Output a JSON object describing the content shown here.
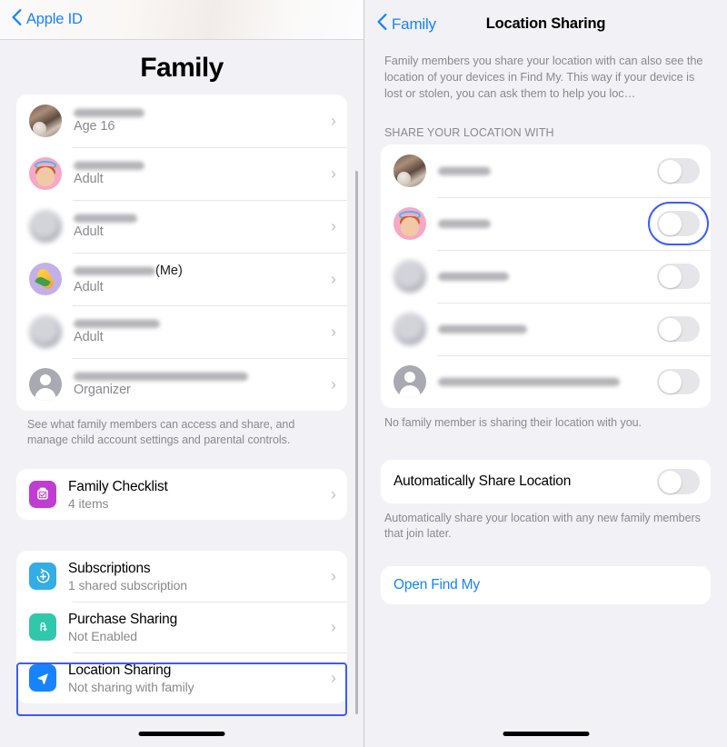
{
  "left_panel": {
    "back": {
      "label": "Apple ID",
      "icon": "chevron-left-icon"
    },
    "title": "Family",
    "members": [
      {
        "avatar": "photo-child",
        "name_redacted": true,
        "name_width": 78,
        "role": "Age 16"
      },
      {
        "avatar": "emoji-angel",
        "name_redacted": true,
        "name_width": 78,
        "role": "Adult"
      },
      {
        "avatar": "blurred-blob",
        "name_redacted": true,
        "name_width": 70,
        "role": "Adult"
      },
      {
        "avatar": "emoji-corn",
        "name_redacted": true,
        "name_width": 90,
        "suffix": "(Me)",
        "role": "Adult"
      },
      {
        "avatar": "blurred-blob",
        "name_redacted": true,
        "name_width": 95,
        "role": "Adult"
      },
      {
        "avatar": "person-placeholder",
        "name_redacted": true,
        "name_width": 192,
        "role": "Organizer"
      }
    ],
    "members_footnote": "See what family members can access and share, and manage child account settings and parental controls.",
    "checklist": {
      "icon": "clipboard-check-icon",
      "icon_color": "#bf3ed1",
      "title": "Family Checklist",
      "subtitle": "4 items"
    },
    "services": [
      {
        "icon": "subscriptions-icon",
        "icon_color": "#32ade6",
        "title": "Subscriptions",
        "subtitle": "1 shared subscription"
      },
      {
        "icon": "purchase-sharing-icon",
        "icon_color": "#2fc8ac",
        "title": "Purchase Sharing",
        "subtitle": "Not Enabled"
      },
      {
        "icon": "location-arrow-icon",
        "icon_color": "#1783ff",
        "title": "Location Sharing",
        "subtitle": "Not sharing with family"
      }
    ],
    "highlight_color": "#3b5bfd"
  },
  "right_panel": {
    "back": {
      "label": "Family",
      "icon": "chevron-left-icon"
    },
    "title": "Location Sharing",
    "description": "Family members you share your location with can also see the location of your devices in Find My. This way if your device is lost or stolen, you can ask them to help you loc…",
    "section_header": "SHARE YOUR LOCATION WITH",
    "share_rows": [
      {
        "avatar": "photo-child",
        "name_redacted": true,
        "name_width": 58,
        "toggle": "off",
        "selected": false
      },
      {
        "avatar": "emoji-angel",
        "name_redacted": true,
        "name_width": 58,
        "toggle": "off",
        "selected": true
      },
      {
        "avatar": "blurred-blob",
        "name_redacted": true,
        "name_width": 78,
        "toggle": "off",
        "selected": false
      },
      {
        "avatar": "blurred-blob",
        "name_redacted": true,
        "name_width": 98,
        "toggle": "off",
        "selected": false
      },
      {
        "avatar": "person-placeholder",
        "name_redacted": true,
        "name_width": 200,
        "toggle": "off",
        "selected": false
      }
    ],
    "share_footnote": "No family member is sharing their location with you.",
    "auto_share": {
      "label": "Automatically Share Location",
      "toggle": "off"
    },
    "auto_share_footnote": "Automatically share your location with any new family members that join later.",
    "open_find_my": "Open Find My"
  }
}
